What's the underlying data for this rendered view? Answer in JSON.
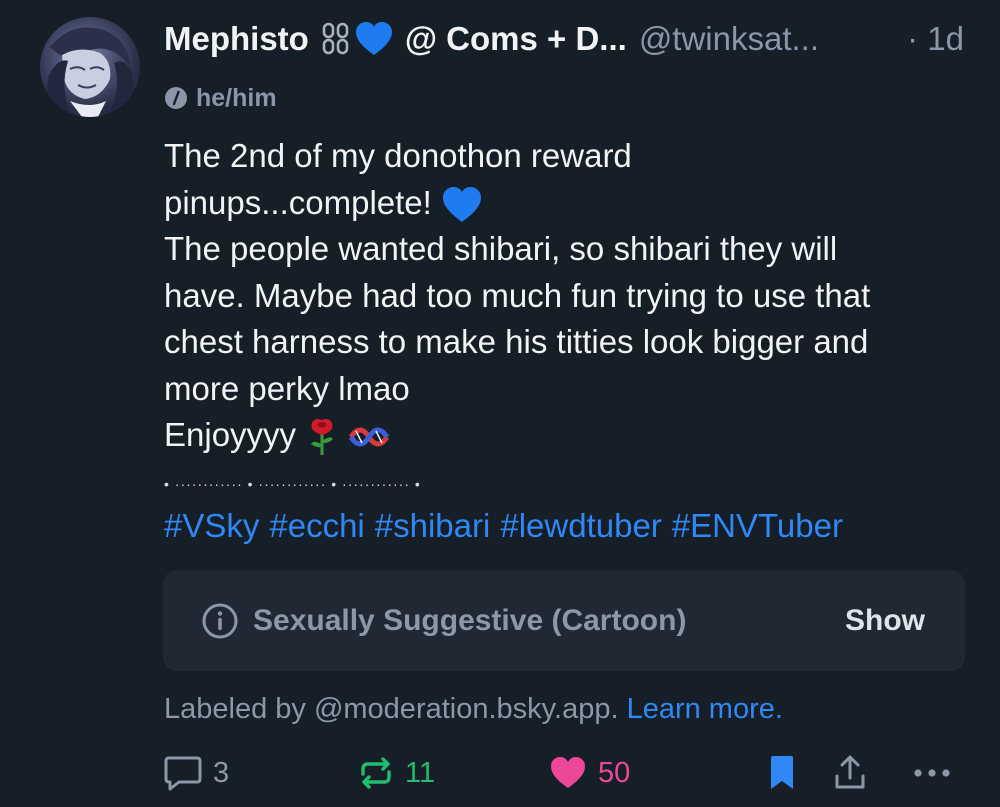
{
  "post": {
    "author": {
      "display_name": "Mephisto",
      "display_name_suffix": "@ Coms + D...",
      "handle": "@twinksat...",
      "time": "· 1d",
      "pronouns": "he/him",
      "name_icons": [
        "chain-icon",
        "blue-heart-icon"
      ],
      "avatar_icon": "avatar-image"
    },
    "text_lines": [
      "The 2nd of my donothon reward",
      "pinups...complete!",
      "The people wanted shibari, so shibari they will",
      "have. Maybe had too much fun trying to use that",
      "chest harness to make his titties look bigger and",
      "more perky lmao",
      "Enjoyyyy"
    ],
    "divider": "• ············ • ············ • ············ •",
    "hashtags": [
      "#VSky",
      "#ecchi",
      "#shibari",
      "#lewdtuber",
      "#ENVTuber"
    ],
    "content_label": {
      "icon": "info-icon",
      "text": "Sexually Suggestive (Cartoon)",
      "action": "Show"
    },
    "labeled_by": {
      "prefix": "Labeled by @moderation.bsky.app.",
      "link": "Learn more."
    },
    "actions": {
      "reply_count": "3",
      "repost_count": "11",
      "like_count": "50"
    }
  },
  "colors": {
    "background": "#161e27",
    "text": "#f1f3f5",
    "muted": "#8a97a8",
    "link": "#2f88f5",
    "repost": "#20bc6f",
    "like": "#ec4899",
    "card": "#1f2833"
  }
}
